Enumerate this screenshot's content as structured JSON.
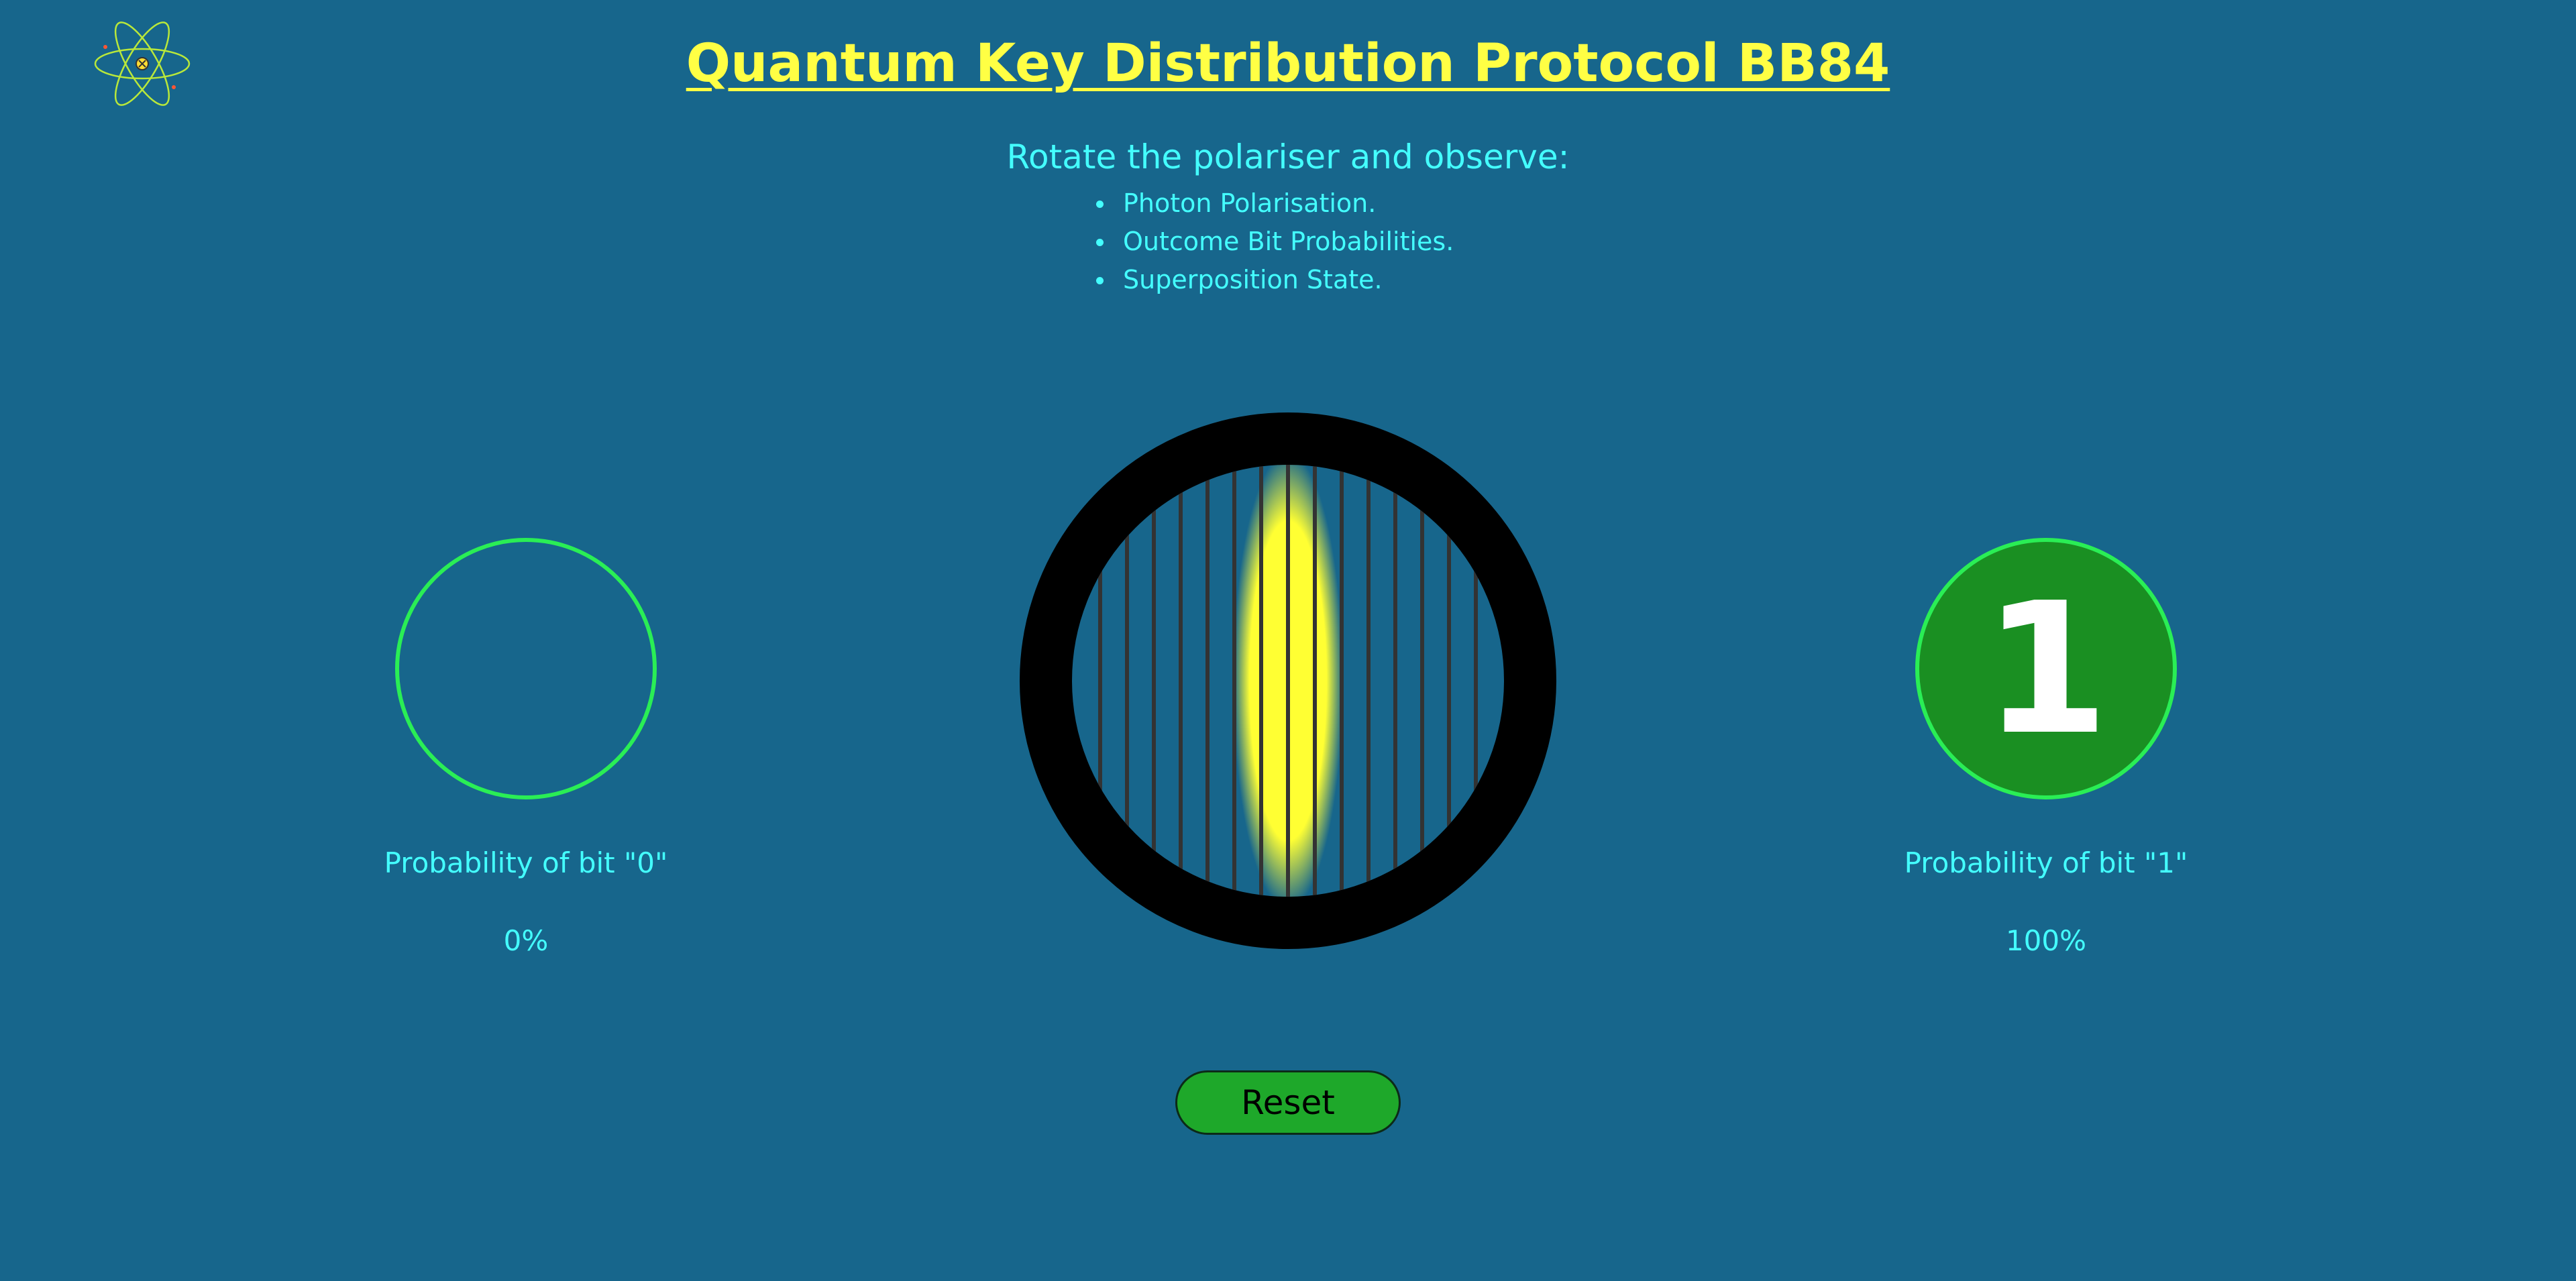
{
  "header": {
    "title": "Quantum Key Distribution Protocol BB84"
  },
  "instructions": {
    "heading": "Rotate the polariser and observe:",
    "items": [
      "Photon Polarisation.",
      "Outcome Bit Probabilities.",
      "Superposition State."
    ]
  },
  "bit_zero": {
    "label": "Probability of bit \"0\"",
    "value": "0%",
    "digit": ""
  },
  "bit_one": {
    "label": "Probability of bit \"1\"",
    "value": "100%",
    "digit": "1"
  },
  "polariser": {
    "angle_degrees": 0,
    "photon_color": "#ffff33",
    "ring_color": "#000000"
  },
  "controls": {
    "reset_label": "Reset"
  },
  "colors": {
    "background": "#17668c",
    "title": "#ffff44",
    "text": "#44ffff",
    "accent_green": "#2aee55",
    "active_fill": "#1a8f22",
    "button": "#1ea82a"
  },
  "icons": {
    "logo": "atom-icon"
  }
}
